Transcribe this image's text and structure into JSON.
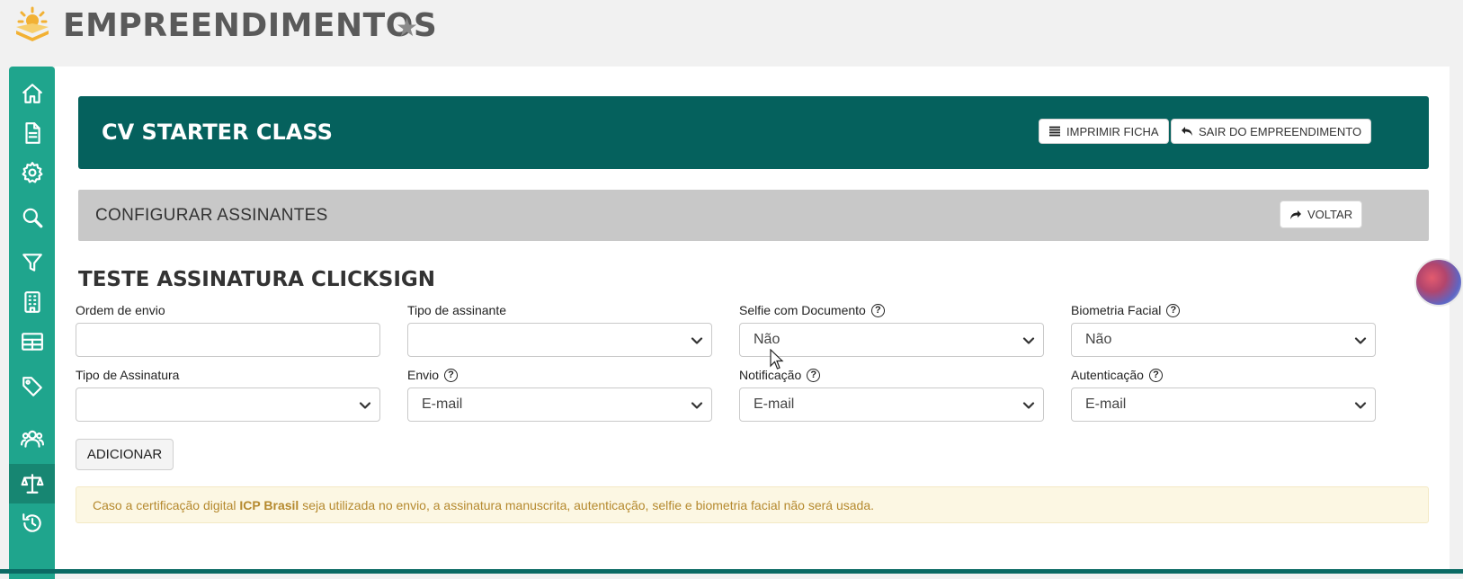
{
  "header": {
    "title": "EMPREENDIMENTOS"
  },
  "sidebar": {
    "items": [
      {
        "icon": "home-icon"
      },
      {
        "icon": "document-icon"
      },
      {
        "icon": "gear-icon"
      },
      {
        "icon": "search-icon"
      },
      {
        "icon": "filter-icon"
      },
      {
        "icon": "building-icon"
      },
      {
        "icon": "table-icon"
      },
      {
        "icon": "tag-icon"
      },
      {
        "icon": "users-icon"
      },
      {
        "icon": "scale-icon",
        "active": true
      },
      {
        "icon": "history-icon"
      }
    ]
  },
  "banner": {
    "title": "CV STARTER CLASS",
    "print_label": "IMPRIMIR FICHA",
    "exit_label": "SAIR DO EMPREENDIMENTO"
  },
  "section": {
    "title": "CONFIGURAR ASSINANTES",
    "back_label": "VOLTAR"
  },
  "form": {
    "title": "TESTE ASSINATURA CLICKSIGN",
    "fields": {
      "ordem": {
        "label": "Ordem de envio",
        "value": ""
      },
      "tipo_assinante": {
        "label": "Tipo de assinante",
        "value": ""
      },
      "selfie": {
        "label": "Selfie com Documento",
        "value": "Não"
      },
      "biometria": {
        "label": "Biometria Facial",
        "value": "Não"
      },
      "tipo_assinatura": {
        "label": "Tipo de Assinatura",
        "value": ""
      },
      "envio": {
        "label": "Envio",
        "value": "E-mail"
      },
      "notificacao": {
        "label": "Notificação",
        "value": "E-mail"
      },
      "autenticacao": {
        "label": "Autenticação",
        "value": "E-mail"
      }
    },
    "add_label": "ADICIONAR"
  },
  "notice": {
    "before": "Caso a certificação digital ",
    "bold": "ICP Brasil",
    "after": " seja utilizada no envio, a assinatura manuscrita, autenticação, selfie e biometria facial não será usada."
  },
  "colors": {
    "sidebar": "#1fa58d",
    "banner": "#05615d",
    "section_bar": "#c8c8c8",
    "notice_bg": "#fcf7e3",
    "notice_text": "#b5892e"
  }
}
